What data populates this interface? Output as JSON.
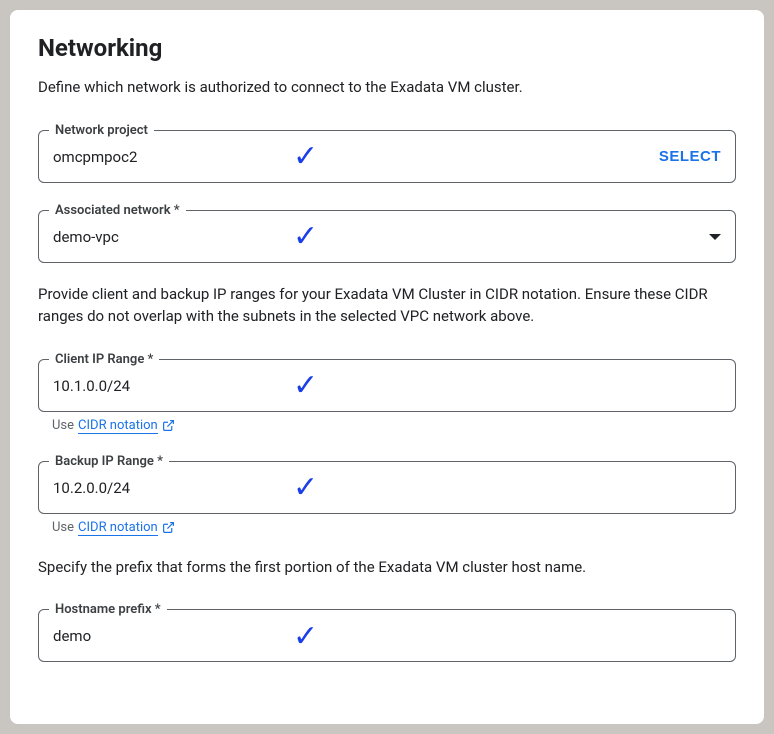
{
  "title": "Networking",
  "desc1": "Define which network is authorized to connect to the Exadata VM cluster.",
  "desc2": "Provide client and backup IP ranges for your Exadata VM Cluster in CIDR notation. Ensure these CIDR ranges do not overlap with the subnets in the selected VPC network above.",
  "desc3": "Specify the prefix that forms the first portion of the Exadata VM cluster host name.",
  "networkProject": {
    "label": "Network project",
    "value": "omcpmpoc2",
    "selectLabel": "SELECT"
  },
  "associatedNetwork": {
    "label": "Associated network *",
    "value": "demo-vpc"
  },
  "clientIp": {
    "label": "Client IP Range *",
    "value": "10.1.0.0/24",
    "helperPrefix": "Use ",
    "helperLink": "CIDR notation"
  },
  "backupIp": {
    "label": "Backup IP Range *",
    "value": "10.2.0.0/24",
    "helperPrefix": "Use ",
    "helperLink": "CIDR notation"
  },
  "hostname": {
    "label": "Hostname prefix *",
    "value": "demo"
  }
}
